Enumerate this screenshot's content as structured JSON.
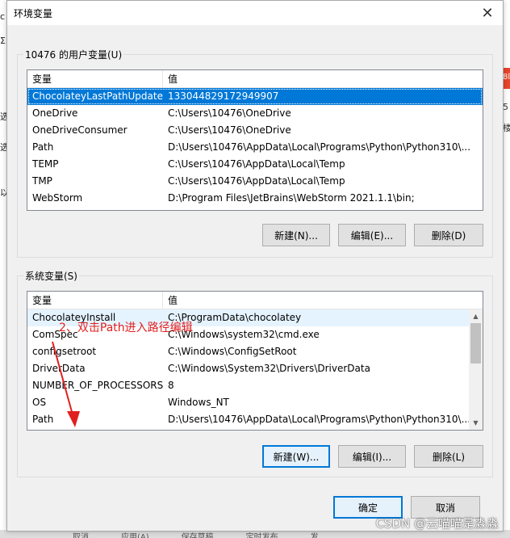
{
  "background": {
    "left_fragments": [
      "c",
      "Σ",
      "选",
      "选",
      "以"
    ],
    "right_fragments": [
      "8l",
      "5",
      "楼"
    ],
    "bottom_fragments": [
      "取消",
      "应用(A)",
      "保存草稿",
      "定时发布",
      "发"
    ]
  },
  "window": {
    "title": "环境变量",
    "close_glyph": "✕"
  },
  "user_vars": {
    "group_label": "10476 的用户变量(U)",
    "headers": [
      "变量",
      "值"
    ],
    "rows": [
      {
        "name": "ChocolateyLastPathUpdate",
        "value": "133044829172949907",
        "selected": true
      },
      {
        "name": "OneDrive",
        "value": "C:\\Users\\10476\\OneDrive"
      },
      {
        "name": "OneDriveConsumer",
        "value": "C:\\Users\\10476\\OneDrive"
      },
      {
        "name": "Path",
        "value": "D:\\Users\\10476\\AppData\\Local\\Programs\\Python\\Python310\\..."
      },
      {
        "name": "TEMP",
        "value": "C:\\Users\\10476\\AppData\\Local\\Temp"
      },
      {
        "name": "TMP",
        "value": "C:\\Users\\10476\\AppData\\Local\\Temp"
      },
      {
        "name": "WebStorm",
        "value": "D:\\Program Files\\JetBrains\\WebStorm 2021.1.1\\bin;"
      }
    ],
    "buttons": {
      "new": "新建(N)...",
      "edit": "编辑(E)...",
      "delete": "删除(D)"
    }
  },
  "system_vars": {
    "group_label": "系统变量(S)",
    "headers": [
      "变量",
      "值"
    ],
    "rows": [
      {
        "name": "ChocolateyInstall",
        "value": "C:\\ProgramData\\chocolatey"
      },
      {
        "name": "ComSpec",
        "value": "C:\\Windows\\system32\\cmd.exe"
      },
      {
        "name": "configsetroot",
        "value": "C:\\Windows\\ConfigSetRoot"
      },
      {
        "name": "DriverData",
        "value": "C:\\Windows\\System32\\Drivers\\DriverData"
      },
      {
        "name": "NUMBER_OF_PROCESSORS",
        "value": "8"
      },
      {
        "name": "OS",
        "value": "Windows_NT"
      },
      {
        "name": "Path",
        "value": "D:\\Users\\10476\\AppData\\Local\\Programs\\Python\\Python310\\..."
      }
    ],
    "buttons": {
      "new": "新建(W)...",
      "edit": "编辑(I)...",
      "delete": "删除(L)"
    }
  },
  "dialog_buttons": {
    "ok": "确定",
    "cancel": "取消"
  },
  "annotation": "2、双击Path进入路径编辑",
  "watermark": "CSDN @云喵喵是淼淼"
}
